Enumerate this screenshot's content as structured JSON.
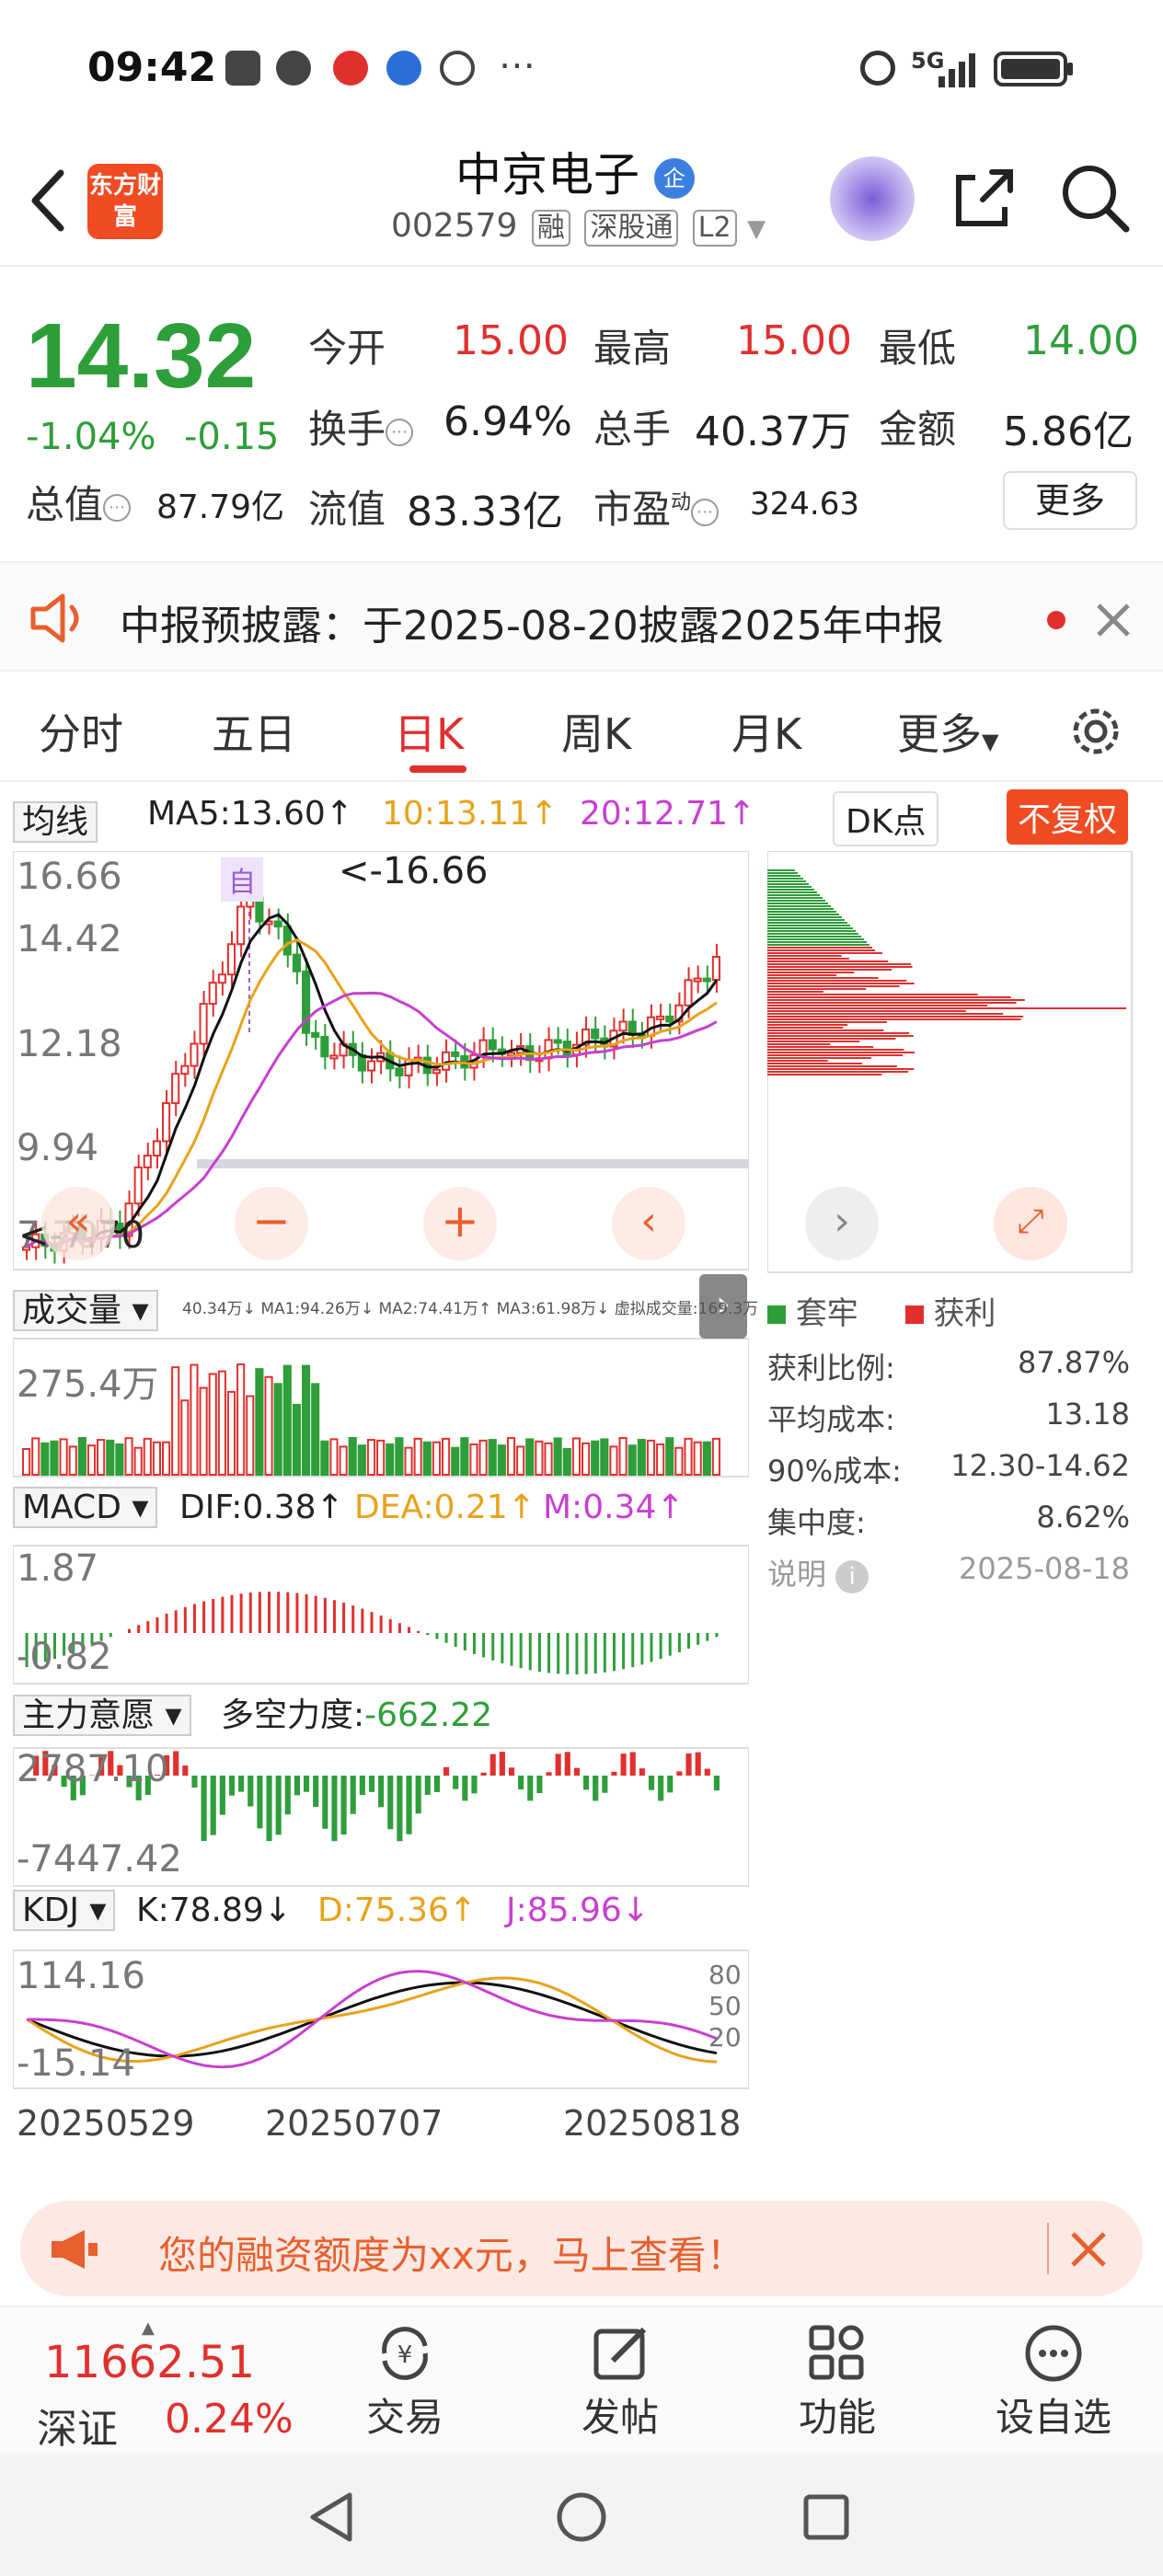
{
  "status_bar": {
    "time": "09:42",
    "network": "5G"
  },
  "header": {
    "logo_text": "东方财富",
    "stock_name": "中京电子",
    "stock_code": "002579",
    "tags": [
      "融",
      "深股通",
      "L2"
    ]
  },
  "quote": {
    "price": "14.32",
    "change_pct": "-1.04%",
    "change": "-0.15",
    "market_cap_label": "总值",
    "market_cap": "87.79亿",
    "fields": [
      {
        "label": "今开",
        "value": "15.00"
      },
      {
        "label": "最高",
        "value": "15.00"
      },
      {
        "label": "最低",
        "value": "14.00"
      },
      {
        "label": "换手",
        "value": "6.94%"
      },
      {
        "label": "总手",
        "value": "40.37万"
      },
      {
        "label": "金额",
        "value": "5.86亿"
      },
      {
        "label": "流值",
        "value": "83.33亿"
      },
      {
        "label": "市盈",
        "value": "324.63"
      }
    ],
    "pe_superscript": "动",
    "more_button": "更多"
  },
  "notice": {
    "text": "中报预披露：于2025-08-20披露2025年中报"
  },
  "tabs": [
    "分时",
    "五日",
    "日K",
    "周K",
    "月K",
    "更多"
  ],
  "active_tab": "日K",
  "chart_header": {
    "ma_dropdown": "均线",
    "ma5": "MA5:13.60↑",
    "ma10": "10:13.11↑",
    "ma20": "20:12.71↑",
    "dk_button": "DK点",
    "adjust_button": "不复权"
  },
  "price_axis": [
    "16.66",
    "14.42",
    "12.18",
    "9.94",
    "7.70"
  ],
  "price_max_label": "<-16.66",
  "price_min_label": "<-7.70",
  "self_marker": "自",
  "volume": {
    "label": "成交量",
    "legend": "40.34万↓ MA1:94.26万↓ MA2:74.41万↑ MA3:61.98万↓ 虚拟成交量:169.3万",
    "max": "275.4万"
  },
  "macd": {
    "label": "MACD",
    "dif": "DIF:0.38↑",
    "dea": "DEA:0.21↑",
    "m": "M:0.34↑",
    "top": "1.87",
    "bottom": "-0.82"
  },
  "main_force": {
    "label": "主力意愿",
    "strength": "多空力度:",
    "strength_value": "-662.22",
    "top": "2787.10",
    "bottom": "-7447.42"
  },
  "kdj": {
    "label": "KDJ",
    "k": "K:78.89↓",
    "d": "D:75.36↑",
    "j": "J:85.96↓",
    "top": "114.16",
    "bottom": "-15.14",
    "levels": [
      "80",
      "50",
      "20"
    ]
  },
  "date_axis": [
    "20250529",
    "20250707",
    "20250818"
  ],
  "chip": {
    "legend_trapped": "套牢",
    "legend_profit": "获利",
    "rows": [
      {
        "label": "获利比例:",
        "value": "87.87%"
      },
      {
        "label": "平均成本:",
        "value": "13.18"
      },
      {
        "label": "90%成本:",
        "value": "12.30-14.62"
      },
      {
        "label": "集中度:",
        "value": "8.62%"
      }
    ],
    "note_label": "说明",
    "date": "2025-08-18"
  },
  "promo": {
    "text": "您的融资额度为xx元，马上查看！"
  },
  "bottom_bar": {
    "index_value": "11662.51",
    "index_name": "深证",
    "index_change": "0.24%",
    "items": [
      "交易",
      "发帖",
      "功能",
      "设自选"
    ]
  },
  "colors": {
    "up": "#e0302e",
    "down": "#2e9e3a",
    "ma10": "#e8a21a",
    "ma20": "#c83fd0",
    "brand": "#f04b22"
  }
}
